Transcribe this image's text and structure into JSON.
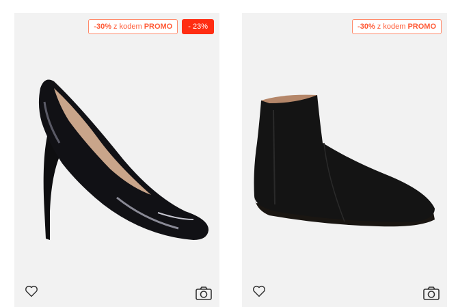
{
  "products": [
    {
      "promo": {
        "discount": "-30%",
        "text": "z kodem",
        "code": "PROMO"
      },
      "discount_badge": "- 23%",
      "image": "black-patent-pump",
      "icons": {
        "wishlist": "heart-icon",
        "view": "camera-icon"
      }
    },
    {
      "promo": {
        "discount": "-30%",
        "text": "z kodem",
        "code": "PROMO"
      },
      "image": "black-suede-chelsea-boot",
      "icons": {
        "wishlist": "heart-icon",
        "view": "camera-icon"
      }
    }
  ],
  "colors": {
    "promo": "#ff5a36",
    "badge": "#ff2d12",
    "card_bg": "#f2f2f2"
  }
}
